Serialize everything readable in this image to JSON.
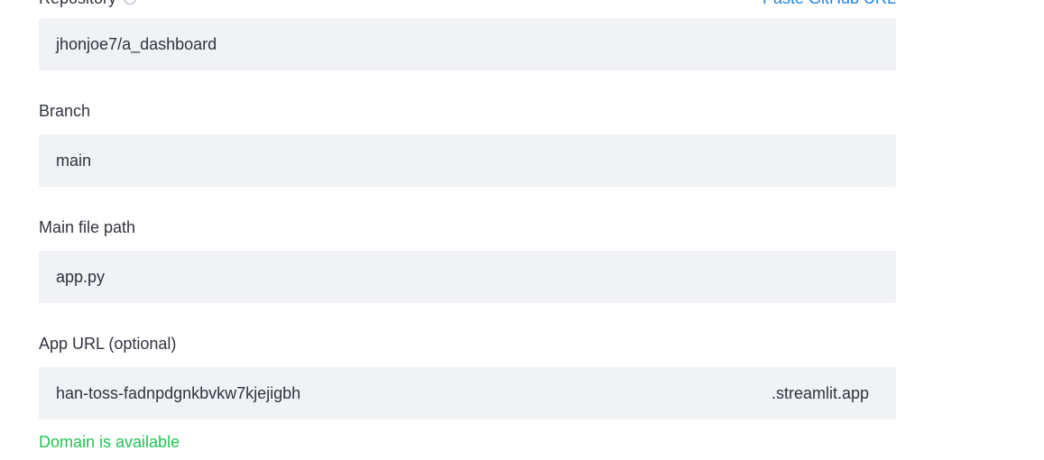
{
  "repository": {
    "label": "Repository",
    "value": "jhonjoe7/a_dashboard",
    "paste_link": "Paste GitHub URL"
  },
  "branch": {
    "label": "Branch",
    "value": "main"
  },
  "main_file": {
    "label": "Main file path",
    "value": "app.py"
  },
  "app_url": {
    "label": "App URL (optional)",
    "value": "han-toss-fadnpdgnkbvkw7kjejigbh",
    "suffix": ".streamlit.app",
    "status": "Domain is available"
  },
  "colors": {
    "input_bg": "#f0f2f6",
    "link": "#1c83e1",
    "success": "#21c354",
    "text": "#31333f"
  }
}
